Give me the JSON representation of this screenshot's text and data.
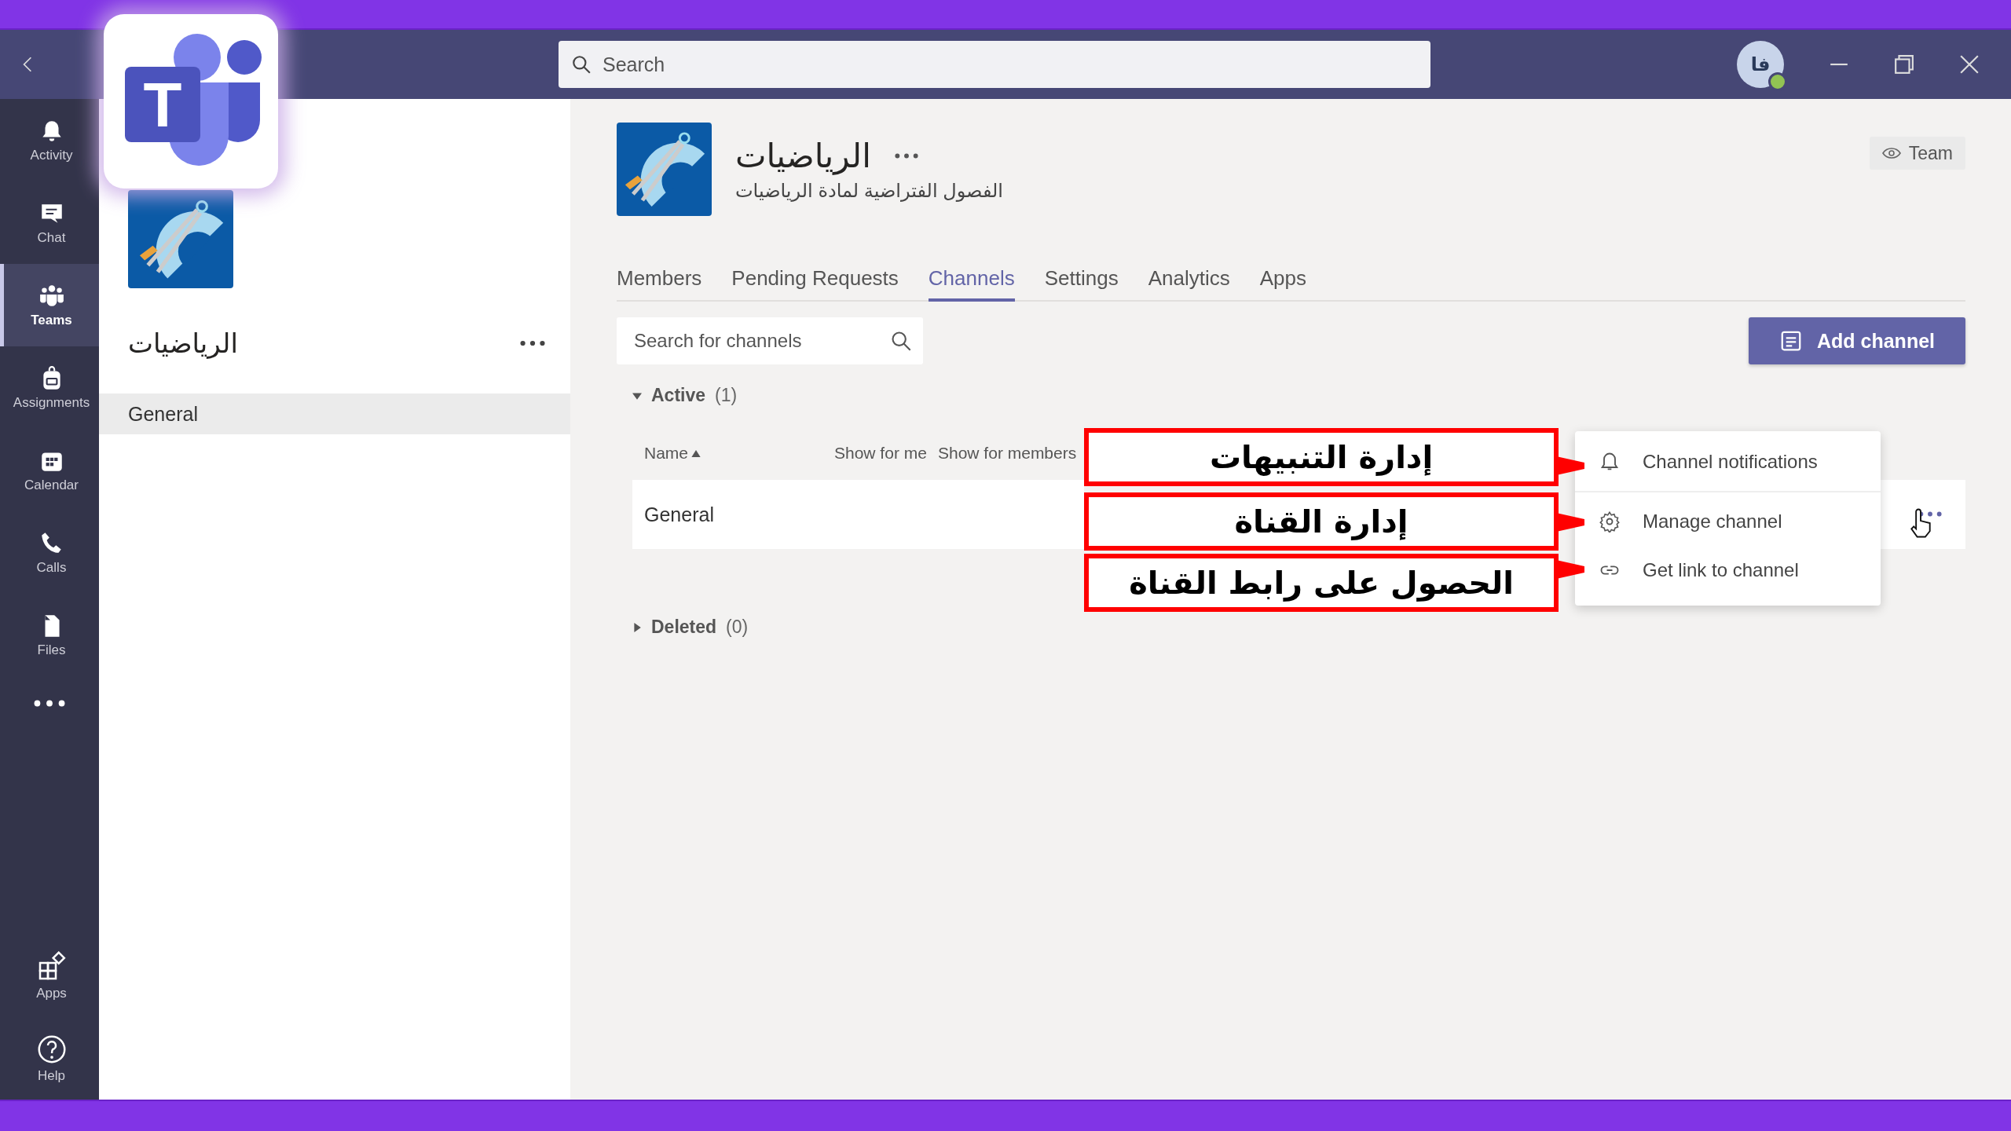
{
  "logo_overlay": {
    "letter": "T"
  },
  "title_bar": {
    "search_placeholder": "Search",
    "avatar_initials": "فا"
  },
  "rail": {
    "items": [
      {
        "label": "Activity",
        "selected": false
      },
      {
        "label": "Chat",
        "selected": false
      },
      {
        "label": "Teams",
        "selected": true
      },
      {
        "label": "Assignments",
        "selected": false
      },
      {
        "label": "Calendar",
        "selected": false
      },
      {
        "label": "Calls",
        "selected": false
      },
      {
        "label": "Files",
        "selected": false
      }
    ],
    "bottom_items": [
      {
        "label": "Apps",
        "selected": false
      },
      {
        "label": "Help",
        "selected": false
      }
    ]
  },
  "team_panel": {
    "name": "الرياضيات",
    "channels": [
      {
        "name": "General",
        "selected": true
      }
    ]
  },
  "team_header": {
    "name": "الرياضيات",
    "description": "الفصول الفتراضية لمادة الرياضيات",
    "view_button": "Team"
  },
  "tabs": [
    {
      "label": "Members",
      "selected": false
    },
    {
      "label": "Pending Requests",
      "selected": false
    },
    {
      "label": "Channels",
      "selected": true
    },
    {
      "label": "Settings",
      "selected": false
    },
    {
      "label": "Analytics",
      "selected": false
    },
    {
      "label": "Apps",
      "selected": false
    }
  ],
  "channel_search": {
    "placeholder": "Search for channels"
  },
  "add_channel_button": "Add channel",
  "sections": [
    {
      "title": "Active",
      "count": "(1)",
      "expanded": true,
      "columns": [
        "Name",
        "Show for me",
        "Show for members"
      ],
      "rows": [
        {
          "name": "General"
        }
      ]
    },
    {
      "title": "Deleted",
      "count": "(0)",
      "expanded": false
    }
  ],
  "context_menu": [
    {
      "label": "Channel notifications"
    },
    {
      "label": "Manage channel"
    },
    {
      "label": "Get link to channel"
    }
  ],
  "annotations": [
    {
      "text": "إدارة التنبيهات"
    },
    {
      "text": "إدارة القناة"
    },
    {
      "text": "الحصول على رابط القناة"
    }
  ]
}
